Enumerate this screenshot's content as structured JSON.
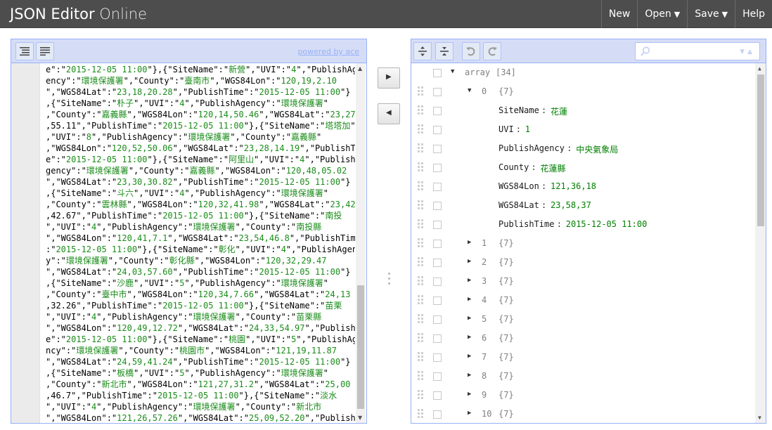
{
  "app": {
    "title_strong": "JSON Editor",
    "title_light": " Online"
  },
  "menu": {
    "new": "New",
    "open": "Open",
    "save": "Save",
    "help": "Help"
  },
  "code_panel": {
    "powered_by": "powered by ace",
    "lines": [
      [
        "e\":\"",
        "2015-12-05 11:00",
        "\"},{\"SiteName\":\"",
        "新營",
        "\",\"UVI\":\"",
        "4",
        "\",\"PublishAge"
      ],
      [
        "ency\":\"",
        "環境保護署",
        "\",\"County\":\"",
        "臺南市",
        "\",\"WGS84Lon\":\"",
        "120,19,2.10",
        ""
      ],
      [
        "\",\"WGS84Lat\":\"",
        "23,18,20.28",
        "\",\"PublishTime\":\"",
        "2015-12-05 11:00",
        "\"}"
      ],
      [
        ",{\"SiteName\":\"",
        "朴子",
        "\",\"UVI\":\"",
        "4",
        "\",\"PublishAgency\":\"",
        "環境保護署",
        "\""
      ],
      [
        ",\"County\":\"",
        "嘉義縣",
        "\",\"WGS84Lon\":\"",
        "120,14,50.46",
        "\",\"WGS84Lat\":\"",
        "23,27",
        ""
      ],
      [
        ",55.11",
        "",
        "\",\"PublishTime\":\"",
        "2015-12-05 11:00",
        "\"},{\"SiteName\":\"",
        "塔塔加",
        "\""
      ],
      [
        ",\"UVI\":\"",
        "8",
        "\",\"PublishAgency\":\"",
        "環境保護署",
        "\",\"County\":\"",
        "嘉義縣",
        "\""
      ],
      [
        ",\"WGS84Lon\":\"",
        "120,52,50.06",
        "\",\"WGS84Lat\":\"",
        "23,28,14.19",
        "\",\"PublishTim"
      ],
      [
        "e\":\"",
        "2015-12-05 11:00",
        "\"},{\"SiteName\":\"",
        "阿里山",
        "\",\"UVI\":\"",
        "4",
        "\",\"PublishA"
      ],
      [
        "gency\":\"",
        "環境保護署",
        "\",\"County\":\"",
        "嘉義縣",
        "\",\"WGS84Lon\":\"",
        "120,48,05.02",
        ""
      ],
      [
        "\",\"WGS84Lat\":\"",
        "23,30,30.82",
        "\",\"PublishTime\":\"",
        "2015-12-05 11:00",
        "\"}"
      ],
      [
        ",{\"SiteName\":\"",
        "斗六",
        "\",\"UVI\":\"",
        "4",
        "\",\"PublishAgency\":\"",
        "環境保護署",
        "\""
      ],
      [
        ",\"County\":\"",
        "雲林縣",
        "\",\"WGS84Lon\":\"",
        "120,32,41.98",
        "\",\"WGS84Lat\":\"",
        "23,42",
        ""
      ],
      [
        ",42.67",
        "",
        "\",\"PublishTime\":\"",
        "2015-12-05 11:00",
        "\"},{\"SiteName\":\"",
        "南投",
        ""
      ],
      [
        "\",\"UVI\":\"",
        "4",
        "\",\"PublishAgency\":\"",
        "環境保護署",
        "\",\"County\":\"",
        "南投縣",
        ""
      ],
      [
        "\",\"WGS84Lon\":\"",
        "120,41,7.1",
        "\",\"WGS84Lat\":\"",
        "23,54,46.8",
        "\",\"PublishTime\""
      ],
      [
        ":\"",
        "2015-12-05 11:00",
        "\"},{\"SiteName\":\"",
        "彰化",
        "\",\"UVI\":\"",
        "4",
        "\",\"PublishAgenc"
      ],
      [
        "y\":\"",
        "環境保護署",
        "\",\"County\":\"",
        "彰化縣",
        "\",\"WGS84Lon\":\"",
        "120,32,29.47",
        ""
      ],
      [
        "\",\"WGS84Lat\":\"",
        "24,03,57.60",
        "\",\"PublishTime\":\"",
        "2015-12-05 11:00",
        "\"}"
      ],
      [
        ",{\"SiteName\":\"",
        "沙鹿",
        "\",\"UVI\":\"",
        "5",
        "\",\"PublishAgency\":\"",
        "環境保護署",
        "\""
      ],
      [
        ",\"County\":\"",
        "臺中市",
        "\",\"WGS84Lon\":\"",
        "120,34,7.66",
        "\",\"WGS84Lat\":\"",
        "24,13",
        ""
      ],
      [
        ",32.26",
        "",
        "\",\"PublishTime\":\"",
        "2015-12-05 11:00",
        "\"},{\"SiteName\":\"",
        "苗栗",
        ""
      ],
      [
        "\",\"UVI\":\"",
        "4",
        "\",\"PublishAgency\":\"",
        "環境保護署",
        "\",\"County\":\"",
        "苗栗縣",
        ""
      ],
      [
        "\",\"WGS84Lon\":\"",
        "120,49,12.72",
        "\",\"WGS84Lat\":\"",
        "24,33,54.97",
        "\",\"PublishTim"
      ],
      [
        "e\":\"",
        "2015-12-05 11:00",
        "\"},{\"SiteName\":\"",
        "桃園",
        "\",\"UVI\":\"",
        "5",
        "\",\"PublishAge"
      ],
      [
        "ncy\":\"",
        "環境保護署",
        "\",\"County\":\"",
        "桃園市",
        "\",\"WGS84Lon\":\"",
        "121,19,11.87",
        ""
      ],
      [
        "\",\"WGS84Lat\":\"",
        "24,59,41.24",
        "\",\"PublishTime\":\"",
        "2015-12-05 11:00",
        "\"}"
      ],
      [
        ",{\"SiteName\":\"",
        "板橋",
        "\",\"UVI\":\"",
        "5",
        "\",\"PublishAgency\":\"",
        "環境保護署",
        "\""
      ],
      [
        ",\"County\":\"",
        "新北市",
        "\",\"WGS84Lon\":\"",
        "121,27,31.2",
        "\",\"WGS84Lat\":\"",
        "25,00",
        ""
      ],
      [
        ",46.7",
        "",
        "\",\"PublishTime\":\"",
        "2015-12-05 11:00",
        "\"},{\"SiteName\":\"",
        "淡水",
        ""
      ],
      [
        "\",\"UVI\":\"",
        "4",
        "\",\"PublishAgency\":\"",
        "環境保護署",
        "\",\"County\":\"",
        "新北市",
        ""
      ],
      [
        "\",\"WGS84Lon\":\"",
        "121,26,57.26",
        "\",\"WGS84Lat\":\"",
        "25,09,52.20",
        "\",\"PublishTim"
      ]
    ]
  },
  "tree_panel": {
    "search_value": "",
    "root": {
      "label": "array",
      "count": "[34]"
    },
    "open_item": {
      "index": "0",
      "count": "{7}",
      "fields": [
        {
          "name": "SiteName",
          "value": "花蓮",
          "type": "str"
        },
        {
          "name": "UVI",
          "value": "1",
          "type": "str"
        },
        {
          "name": "PublishAgency",
          "value": "中央氣象局",
          "type": "str"
        },
        {
          "name": "County",
          "value": "花蓮縣",
          "type": "str"
        },
        {
          "name": "WGS84Lon",
          "value": "121,36,18",
          "type": "str"
        },
        {
          "name": "WGS84Lat",
          "value": "23,58,37",
          "type": "str"
        },
        {
          "name": "PublishTime",
          "value": "2015-12-05 11:00",
          "type": "str"
        }
      ]
    },
    "collapsed_items": [
      {
        "index": "1",
        "count": "{7}"
      },
      {
        "index": "2",
        "count": "{7}"
      },
      {
        "index": "3",
        "count": "{7}"
      },
      {
        "index": "4",
        "count": "{7}"
      },
      {
        "index": "5",
        "count": "{7}"
      },
      {
        "index": "6",
        "count": "{7}"
      },
      {
        "index": "7",
        "count": "{7}"
      },
      {
        "index": "8",
        "count": "{7}"
      },
      {
        "index": "9",
        "count": "{7}"
      },
      {
        "index": "10",
        "count": "{7}"
      }
    ]
  },
  "icons": {
    "format": "format-icon",
    "compact": "compact-icon",
    "expand_all": "expand-all-icon",
    "collapse_all": "collapse-all-icon",
    "undo": "undo-icon",
    "redo": "redo-icon",
    "search": "search-icon",
    "copy_to_tree": "arrow-right-icon",
    "copy_to_code": "arrow-left-icon"
  },
  "colors": {
    "header_bg": "#4d4d4d",
    "panel_border": "#97b0f8",
    "toolbar_bg": "#d5ddf6",
    "string_value": "#008000",
    "code_string": "#1a8c1a"
  }
}
